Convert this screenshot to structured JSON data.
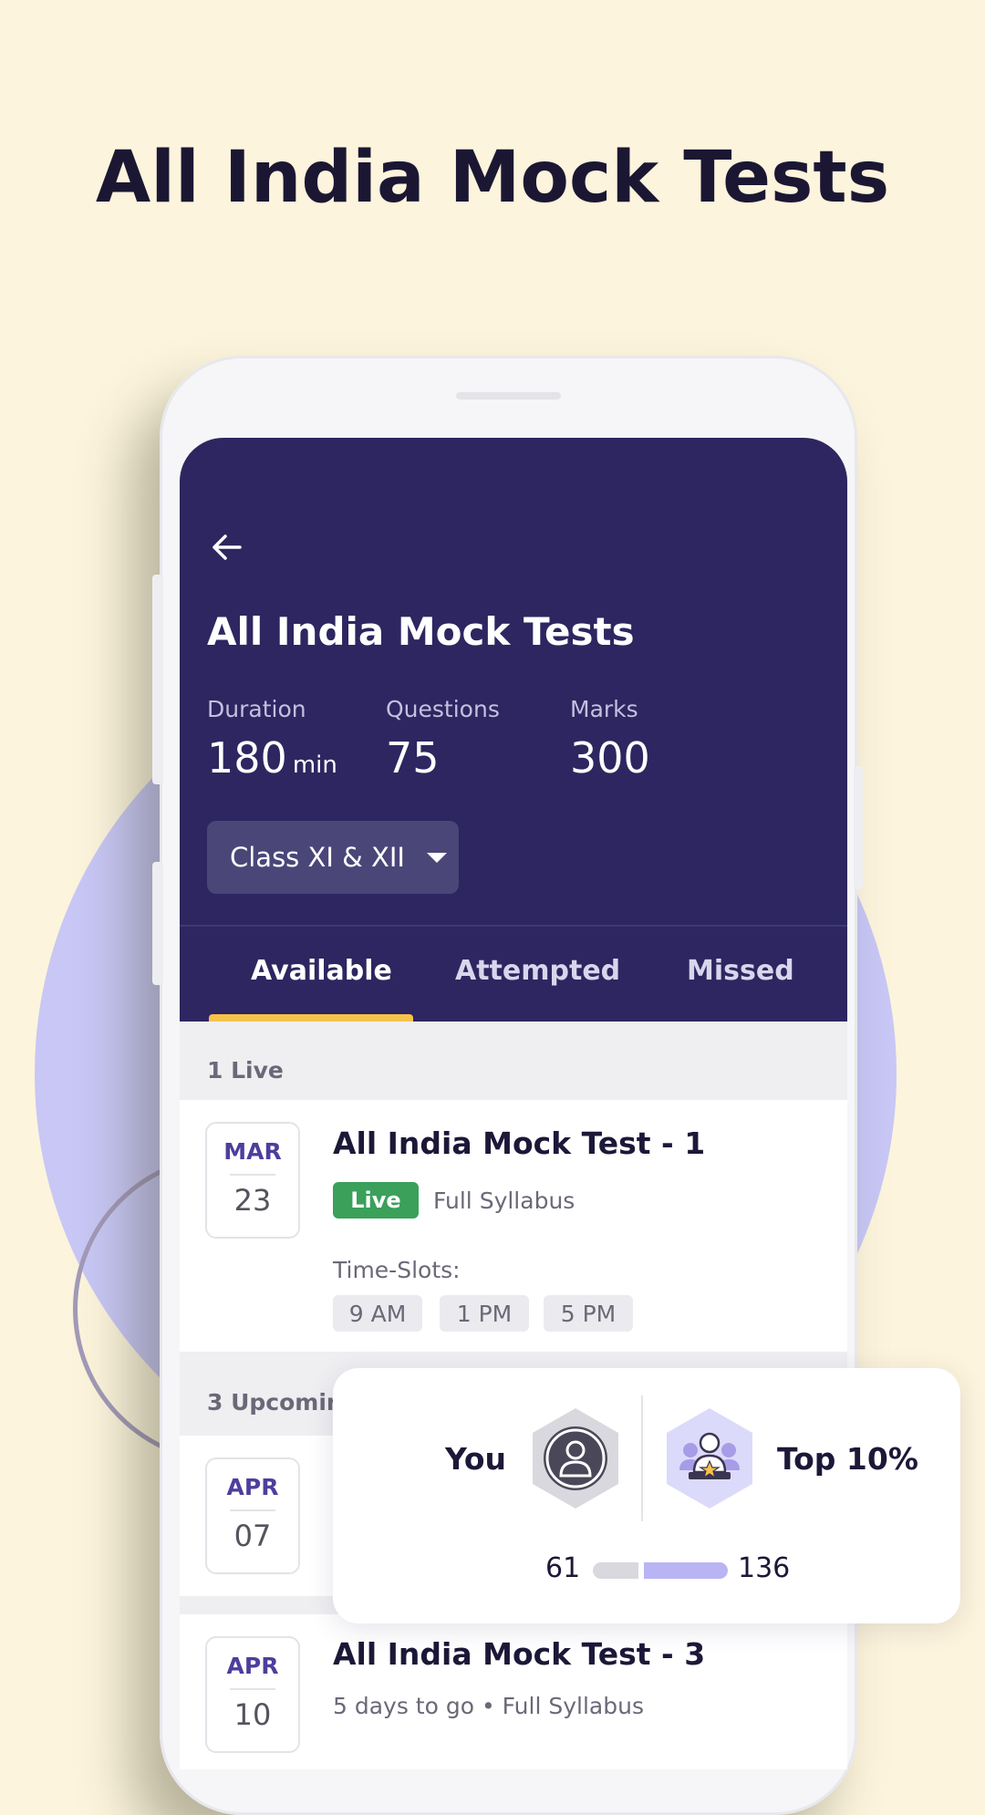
{
  "promo": {
    "headline": "All India Mock Tests"
  },
  "header": {
    "title": "All India Mock Tests",
    "stats": [
      {
        "label": "Duration",
        "value": "180",
        "unit": "min"
      },
      {
        "label": "Questions",
        "value": "75"
      },
      {
        "label": "Marks",
        "value": "300"
      }
    ],
    "class_select": {
      "value": "Class XI & XII"
    }
  },
  "tabs": [
    {
      "label": "Available",
      "active": true
    },
    {
      "label": "Attempted"
    },
    {
      "label": "Missed"
    }
  ],
  "sections": {
    "live": {
      "label": "1 Live"
    },
    "upcoming": {
      "label": "3 Upcomin"
    }
  },
  "tests": [
    {
      "month": "MAR",
      "day": "23",
      "title": "All India Mock Test - 1",
      "badge": "Live",
      "syllabus": "Full Syllabus",
      "slots_label": "Time-Slots:",
      "slots": [
        "9 AM",
        "1 PM",
        "5 PM"
      ]
    },
    {
      "month": "APR",
      "day": "07"
    },
    {
      "month": "APR",
      "day": "10",
      "title": "All India Mock Test - 3",
      "subtitle": "5 days to go • Full Syllabus"
    }
  ],
  "rank_card": {
    "you_label": "You",
    "top_label": "Top 10%",
    "you_rank": "61",
    "top_rank": "136"
  },
  "colors": {
    "background": "#fcf4dc",
    "header": "#2d2660",
    "accent_tab": "#f7c24a",
    "live_badge": "#3aa05a",
    "month_text": "#4c3f9c"
  }
}
